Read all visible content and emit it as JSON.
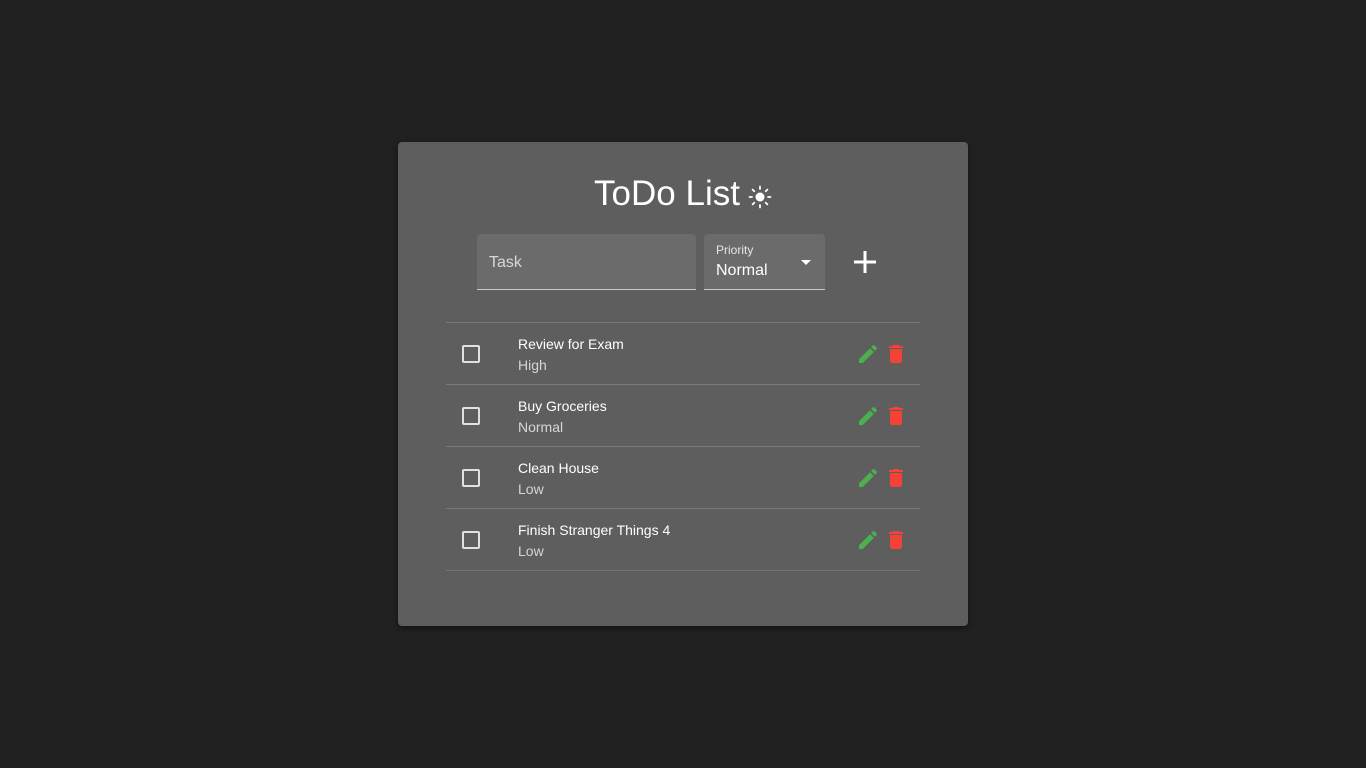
{
  "app": {
    "title": "ToDo List",
    "theme_icon": "sun-icon"
  },
  "form": {
    "task_placeholder": "Task",
    "task_value": "",
    "priority_label": "Priority",
    "priority_value": "Normal",
    "add_icon": "plus-icon"
  },
  "todos": [
    {
      "name": "Review for Exam",
      "priority": "High",
      "checked": false
    },
    {
      "name": "Buy Groceries",
      "priority": "Normal",
      "checked": false
    },
    {
      "name": "Clean House",
      "priority": "Low",
      "checked": false
    },
    {
      "name": "Finish Stranger Things 4",
      "priority": "Low",
      "checked": false
    }
  ],
  "colors": {
    "background": "#212121",
    "card": "#5e5e5e",
    "edit": "#4caf50",
    "delete": "#f44336"
  },
  "icons": {
    "edit": "pencil-icon",
    "delete": "trash-icon",
    "checkbox": "checkbox-icon"
  }
}
